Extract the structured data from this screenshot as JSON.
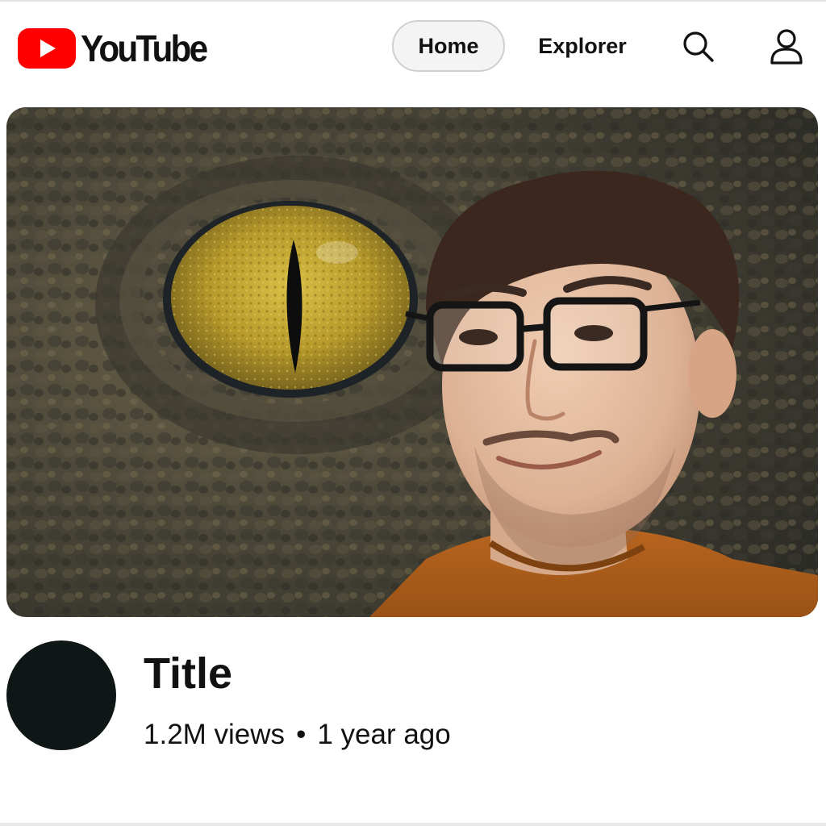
{
  "header": {
    "logo_text": "YouTube",
    "logo_color": "#ff0000",
    "nav": {
      "home_label": "Home",
      "explorer_label": "Explorer"
    },
    "icons": {
      "search": "search-icon",
      "account": "account-icon"
    }
  },
  "video": {
    "title": "Title",
    "views": "1.2M views",
    "separator": "•",
    "age": "1 year ago",
    "thumbnail_subjects": [
      "reptile-eye",
      "man-with-glasses"
    ]
  },
  "colors": {
    "background": "#ffffff",
    "text": "#111111",
    "pill_border": "#cfcfcf",
    "avatar": "#0f1716"
  }
}
